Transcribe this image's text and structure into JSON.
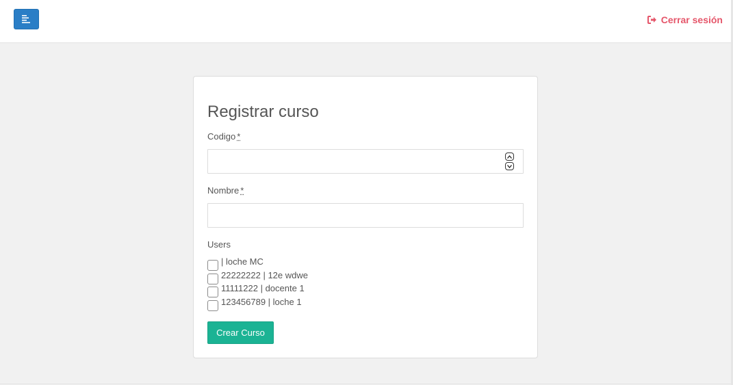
{
  "topbar": {
    "menu_icon": "bars-left-icon",
    "logout_icon": "sign-out-icon",
    "logout_label": "Cerrar sesión",
    "accent_color": "#e5566a",
    "menu_color": "#2a7ec6"
  },
  "form": {
    "title": "Registrar curso",
    "codigo_label": "Codigo",
    "codigo_required": "*",
    "codigo_value": "",
    "nombre_label": "Nombre",
    "nombre_required": "*",
    "nombre_value": "",
    "users_label": "Users",
    "users": [
      {
        "label": "| loche MC",
        "checked": false
      },
      {
        "label": "22222222 | 12e wdwe",
        "checked": false
      },
      {
        "label": "11111222 | docente 1",
        "checked": false
      },
      {
        "label": "123456789 | loche 1",
        "checked": false
      }
    ],
    "submit_label": "Crear Curso",
    "submit_color": "#1bb394"
  }
}
